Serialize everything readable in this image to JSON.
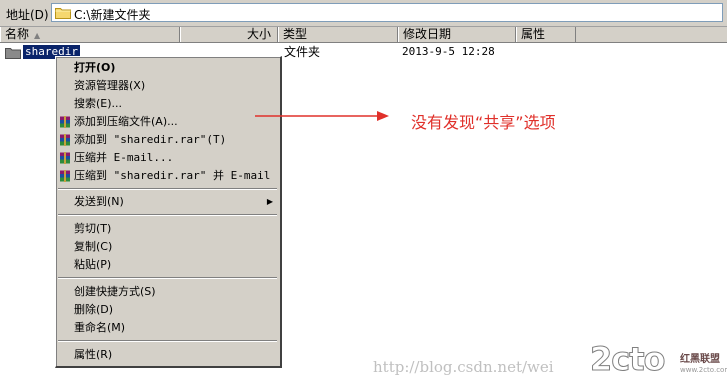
{
  "address_bar": {
    "label": "地址(D)",
    "path": "C:\\新建文件夹"
  },
  "columns": {
    "name": "名称",
    "size": "大小",
    "type": "类型",
    "modified": "修改日期",
    "attributes": "属性"
  },
  "file": {
    "name": "sharedir",
    "type": "文件夹",
    "modified": "2013-9-5 12:28"
  },
  "context_menu": {
    "items": [
      {
        "label": "打开(O)"
      },
      {
        "label": "资源管理器(X)"
      },
      {
        "label": "搜索(E)..."
      },
      {
        "label": "添加到压缩文件(A)..."
      },
      {
        "label": "添加到 \"sharedir.rar\"(T)"
      },
      {
        "label": "压缩并 E-mail..."
      },
      {
        "label": "压缩到 \"sharedir.rar\" 并 E-mail"
      },
      {
        "label": "发送到(N)"
      },
      {
        "label": "剪切(T)"
      },
      {
        "label": "复制(C)"
      },
      {
        "label": "粘贴(P)"
      },
      {
        "label": "创建快捷方式(S)"
      },
      {
        "label": "删除(D)"
      },
      {
        "label": "重命名(M)"
      },
      {
        "label": "属性(R)"
      }
    ]
  },
  "annotation": {
    "text": "没有发现“共享”选项",
    "color": "#e0302a"
  },
  "watermark": {
    "url": "http://blog.csdn.net/wei",
    "logo_main": "2cto",
    "logo_sub": "红黑联盟",
    "logo_url": "www.2cto.com"
  },
  "icons": {
    "folder": "folder-icon",
    "winrar": "winrar-icon",
    "submenu": "chevron-right-icon",
    "sort": "sort-ascending-icon"
  },
  "colors": {
    "chrome": "#d4d0c8",
    "selection": "#0a246a",
    "annotation": "#e0302a"
  }
}
